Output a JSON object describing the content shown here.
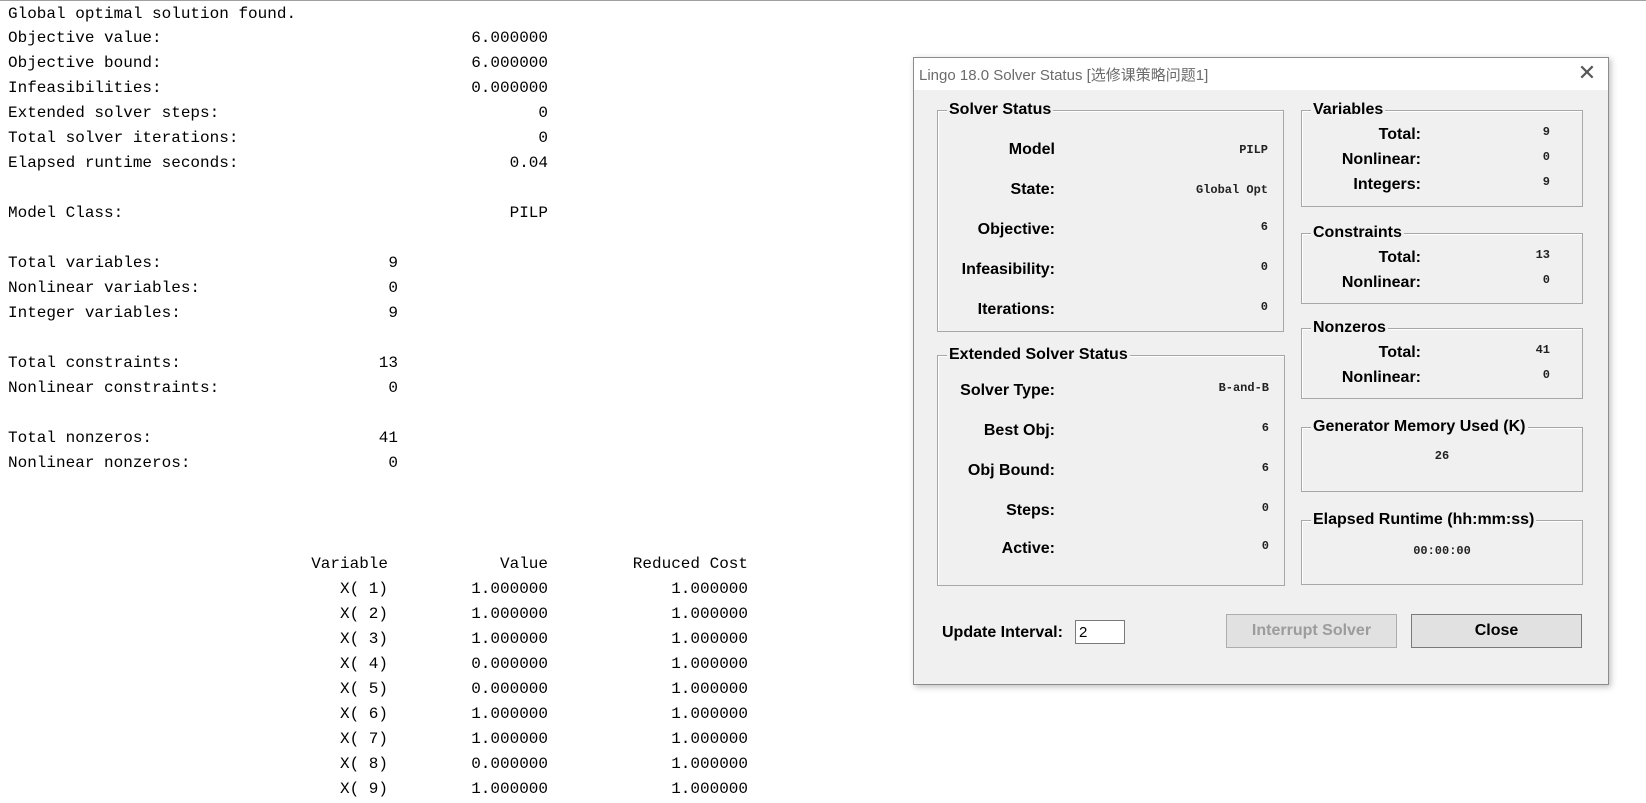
{
  "report": {
    "summary": [
      {
        "label": "Global optimal solution found.",
        "value": ""
      },
      {
        "label": "Objective value:",
        "value": "6.000000"
      },
      {
        "label": "Objective bound:",
        "value": "6.000000"
      },
      {
        "label": "Infeasibilities:",
        "value": "0.000000"
      },
      {
        "label": "Extended solver steps:",
        "value": "0"
      },
      {
        "label": "Total solver iterations:",
        "value": "0"
      },
      {
        "label": "Elapsed runtime seconds:",
        "value": "0.04"
      }
    ],
    "model_class": {
      "label": "Model Class:",
      "value": "PILP"
    },
    "variables": [
      {
        "label": "Total variables:",
        "value": "9"
      },
      {
        "label": "Nonlinear variables:",
        "value": "0"
      },
      {
        "label": "Integer variables:",
        "value": "9"
      }
    ],
    "constraints": [
      {
        "label": "Total constraints:",
        "value": "13"
      },
      {
        "label": "Nonlinear constraints:",
        "value": "0"
      }
    ],
    "nonzeros": [
      {
        "label": "Total nonzeros:",
        "value": "41"
      },
      {
        "label": "Nonlinear nonzeros:",
        "value": "0"
      }
    ],
    "table": {
      "headers": [
        "Variable",
        "Value",
        "Reduced Cost"
      ],
      "rows": [
        [
          "X( 1)",
          "1.000000",
          "1.000000"
        ],
        [
          "X( 2)",
          "1.000000",
          "1.000000"
        ],
        [
          "X( 3)",
          "1.000000",
          "1.000000"
        ],
        [
          "X( 4)",
          "0.000000",
          "1.000000"
        ],
        [
          "X( 5)",
          "0.000000",
          "1.000000"
        ],
        [
          "X( 6)",
          "1.000000",
          "1.000000"
        ],
        [
          "X( 7)",
          "1.000000",
          "1.000000"
        ],
        [
          "X( 8)",
          "0.000000",
          "1.000000"
        ],
        [
          "X( 9)",
          "1.000000",
          "1.000000"
        ]
      ]
    }
  },
  "dialog": {
    "title": "Lingo 18.0 Solver Status [选修课策略问题1]",
    "close_glyph": "✕",
    "solver_status": {
      "title": "Solver Status",
      "fields": [
        {
          "label": "Model",
          "value": "PILP"
        },
        {
          "label": "State:",
          "value": "Global Opt"
        },
        {
          "label": "Objective:",
          "value": "6"
        },
        {
          "label": "Infeasibility:",
          "value": "0"
        },
        {
          "label": "Iterations:",
          "value": "0"
        }
      ]
    },
    "extended_status": {
      "title": "Extended Solver Status",
      "fields": [
        {
          "label": "Solver Type:",
          "value": "B-and-B"
        },
        {
          "label": "Best Obj:",
          "value": "6"
        },
        {
          "label": "Obj Bound:",
          "value": "6"
        },
        {
          "label": "Steps:",
          "value": "0"
        },
        {
          "label": "Active:",
          "value": "0"
        }
      ]
    },
    "variables": {
      "title": "Variables",
      "fields": [
        {
          "label": "Total:",
          "value": "9"
        },
        {
          "label": "Nonlinear:",
          "value": "0"
        },
        {
          "label": "Integers:",
          "value": "9"
        }
      ]
    },
    "constraints": {
      "title": "Constraints",
      "fields": [
        {
          "label": "Total:",
          "value": "13"
        },
        {
          "label": "Nonlinear:",
          "value": "0"
        }
      ]
    },
    "nonzeros": {
      "title": "Nonzeros",
      "fields": [
        {
          "label": "Total:",
          "value": "41"
        },
        {
          "label": "Nonlinear:",
          "value": "0"
        }
      ]
    },
    "generator_memory": {
      "title": "Generator Memory Used (K)",
      "value": "26"
    },
    "elapsed_runtime": {
      "title": "Elapsed Runtime (hh:mm:ss)",
      "value": "00:00:00"
    },
    "update_interval": {
      "label": "Update Interval:",
      "value": "2"
    },
    "buttons": {
      "interrupt": "Interrupt Solver",
      "close": "Close"
    }
  }
}
